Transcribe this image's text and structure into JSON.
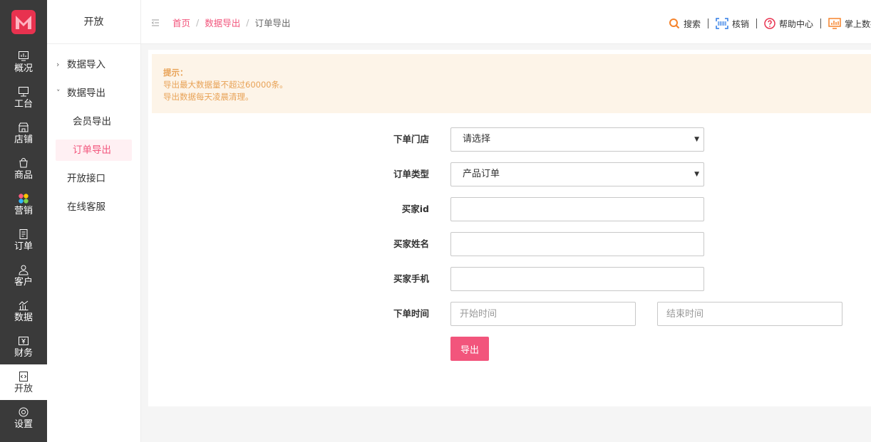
{
  "colors": {
    "accent": "#f2557c",
    "rail_bg": "#3a3a3a",
    "notice_bg": "#fdf4e8",
    "notice_text": "#e8a256"
  },
  "rail": {
    "items": [
      {
        "label": "概况",
        "icon": "monitor-chart-icon"
      },
      {
        "label": "工台",
        "icon": "desktop-icon"
      },
      {
        "label": "店铺",
        "icon": "store-icon"
      },
      {
        "label": "商品",
        "icon": "shopping-bag-icon"
      },
      {
        "label": "营销",
        "icon": "marketing-dots-icon"
      },
      {
        "label": "订单",
        "icon": "order-doc-icon"
      },
      {
        "label": "客户",
        "icon": "user-icon"
      },
      {
        "label": "数据",
        "icon": "bar-chart-icon"
      },
      {
        "label": "财务",
        "icon": "yen-icon"
      },
      {
        "label": "开放",
        "icon": "code-doc-icon",
        "active": true
      },
      {
        "label": "设置",
        "icon": "gear-icon"
      }
    ]
  },
  "sidebar": {
    "title": "开放",
    "items": [
      {
        "label": "数据导入",
        "chevron": "›"
      },
      {
        "label": "数据导出",
        "chevron": "˅",
        "children": [
          {
            "label": "会员导出"
          },
          {
            "label": "订单导出",
            "active": true
          }
        ]
      },
      {
        "label": "开放接口"
      },
      {
        "label": "在线客服"
      }
    ]
  },
  "header": {
    "breadcrumb": [
      "首页",
      "数据导出",
      "订单导出"
    ],
    "breadcrumb_sep": "/",
    "tools": [
      {
        "label": "搜索",
        "icon": "search-icon"
      },
      {
        "label": "核销",
        "icon": "scan-icon"
      },
      {
        "label": "帮助中心",
        "icon": "help-icon"
      },
      {
        "label": "掌上数据",
        "icon": "data-screen-icon"
      }
    ]
  },
  "notice": {
    "title": "提示：",
    "lines": [
      "导出最大数据量不超过60000条。",
      "导出数据每天凌晨清理。"
    ]
  },
  "form": {
    "store": {
      "label": "下单门店",
      "value": "请选择"
    },
    "order_type": {
      "label": "订单类型",
      "value": "产品订单"
    },
    "buyer_id": {
      "label": "买家id",
      "value": ""
    },
    "buyer_name": {
      "label": "买家姓名",
      "value": ""
    },
    "buyer_phone": {
      "label": "买家手机",
      "value": ""
    },
    "order_time": {
      "label": "下单时间",
      "start_placeholder": "开始时间",
      "end_placeholder": "结束时间"
    },
    "caret": "▼",
    "export_label": "导出"
  }
}
